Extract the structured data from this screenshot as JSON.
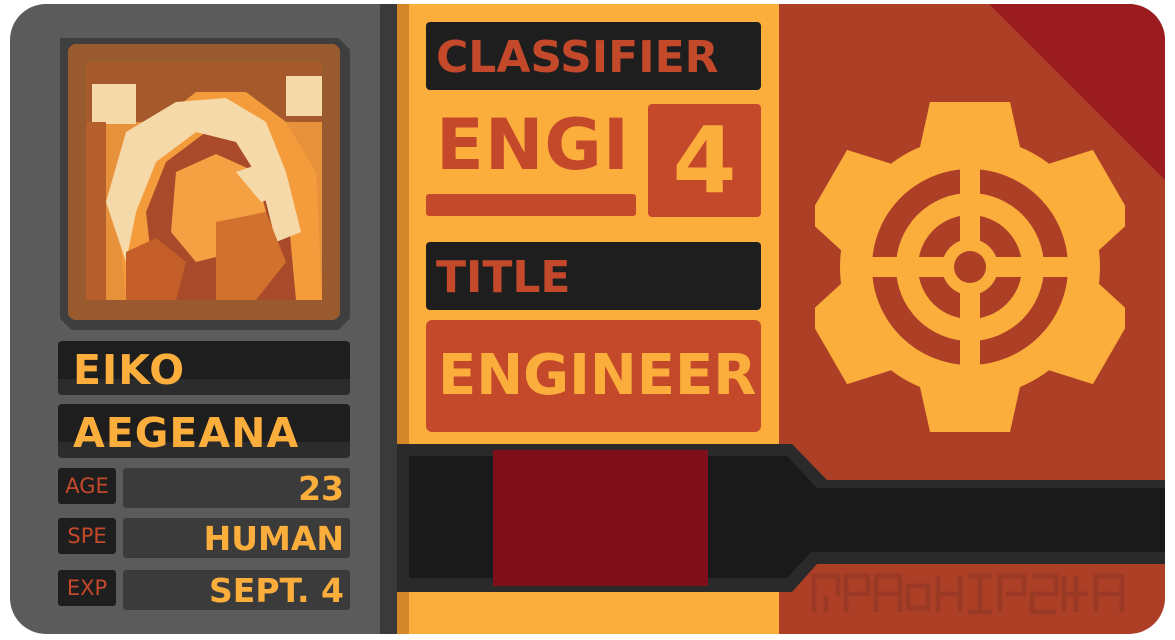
{
  "card": {
    "name_first": "EIKO",
    "name_last": "AEGEANA",
    "stats": [
      {
        "label": "AGE",
        "value": "23"
      },
      {
        "label": "SPE",
        "value": "HUMAN"
      },
      {
        "label": "EXP",
        "value": "SEPT. 4"
      }
    ],
    "classifier_label": "CLASSIFIER",
    "classifier_code": "ENGI",
    "classifier_number": "4",
    "title_label": "TITLE",
    "title_value": "ENGINEER",
    "emblem_icon": "gear-crosshair-icon",
    "portrait_icon": "hooded-figure-portrait",
    "colors": {
      "accent": "#fbae3c",
      "red": "#c4492b",
      "dark_red": "#800f1c",
      "panel_gray": "#5b5b5b",
      "bar_dark": "#1e1e1e",
      "rust": "#ad3f27"
    }
  }
}
